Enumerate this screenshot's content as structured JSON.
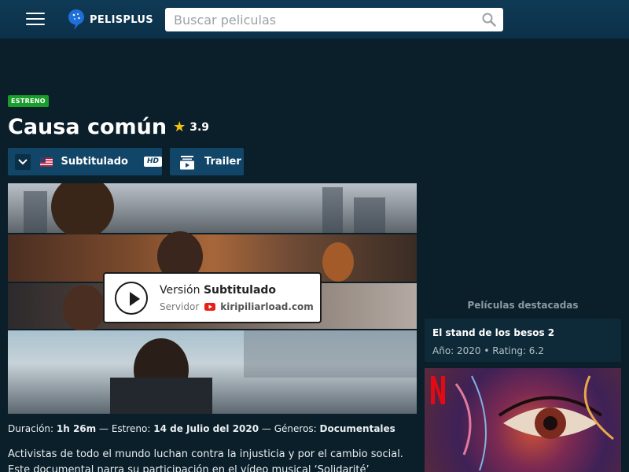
{
  "header": {
    "brand": "PELISPLUS",
    "search_placeholder": "Buscar peliculas"
  },
  "movie": {
    "badge": "ESTRENO",
    "title": "Causa común",
    "rating": "3.9",
    "language_label": "Subtitulado",
    "quality": "HD",
    "trailer_label": "Trailer"
  },
  "player": {
    "version_prefix": "Versión",
    "version_value": "Subtitulado",
    "server_label": "Servidor",
    "server_name": "kiripiliarload.com"
  },
  "details": {
    "duration_label": "Duración:",
    "duration": "1h 26m",
    "release_label": "Estreno:",
    "release": "14 de Julio del 2020",
    "genres_label": "Géneros:",
    "genres": "Documentales",
    "description": "Activistas de todo el mundo luchan contra la injusticia y por el cambio social. Este documental narra su participación en el vídeo musical ‘Solidarité’"
  },
  "sidebar": {
    "title": "Películas destacadas",
    "featured": {
      "name": "El stand de los besos 2",
      "meta": "Año: 2020 • Rating: 6.2"
    }
  },
  "colors": {
    "background": "#0b1f2a",
    "header": "#0f3a55",
    "button": "#124668",
    "badge": "#1a9d2a",
    "star": "#f4c20d"
  },
  "icons": [
    "menu-icon",
    "logo-icon",
    "search-icon",
    "chevron-down-icon",
    "us-flag-icon",
    "hd-icon",
    "trailer-icon",
    "play-icon",
    "youtube-icon",
    "netflix-icon"
  ]
}
